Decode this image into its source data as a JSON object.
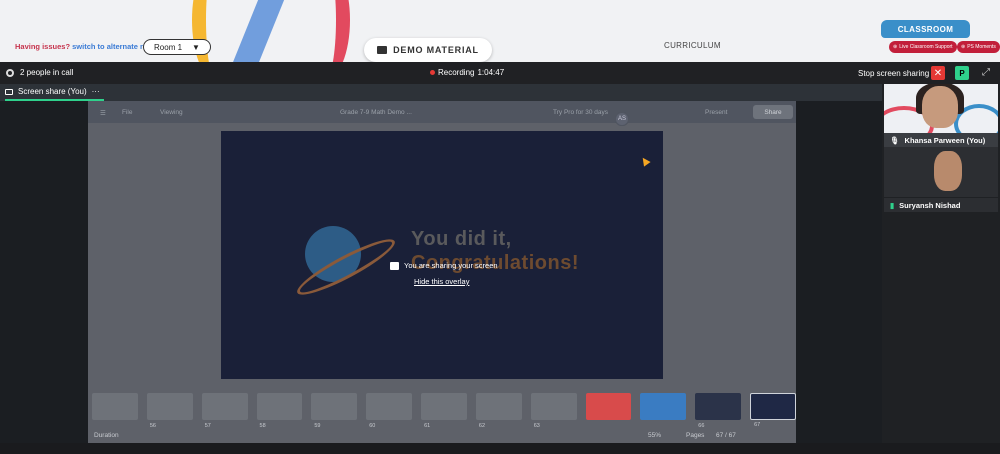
{
  "header": {
    "issue_prefix": "Having issues?",
    "issue_link": "switch to alternate room",
    "room_label": "Room 1",
    "room_caret": "▼",
    "demo_material": "DEMO MATERIAL",
    "curriculum": "CURRICULUM",
    "classroom_tab": "CLASSROOM",
    "live_support": "Live Classroom Support",
    "ps_moments": "PS Moments"
  },
  "callbar": {
    "people": "2 people in call",
    "recording_label": "Recording",
    "recording_time": "1:04:47",
    "stop_sharing": "Stop screen sharing",
    "close_glyph": "✕",
    "p_label": "P",
    "expand_glyph": "⤢"
  },
  "share_tab": {
    "label": "Screen share (You)",
    "more": "···"
  },
  "shared_app": {
    "menu_glyph": "☰",
    "file": "File",
    "viewing": "Viewing",
    "doc_title": "Grade 7-9 Math Demo ...",
    "try_pro": "Try Pro for 30 days",
    "avatars": [
      "#6a8e5a",
      "#3e7bb8",
      "#c96b3b",
      "#8a5aa8"
    ],
    "avatar_text": "AS",
    "present": "Present",
    "share": "Share",
    "slide_line1": "You did it,",
    "slide_line2": "Congratulations!",
    "thumb_numbers": [
      "",
      "56",
      "57",
      "58",
      "59",
      "60",
      "61",
      "62",
      "63",
      "",
      "",
      "66",
      "67"
    ],
    "duration": "Duration",
    "zoom": "55%",
    "pages": "Pages",
    "page_count": "67 / 67"
  },
  "overlay": {
    "sharing_msg": "You are sharing your screen",
    "hide_link": "Hide this overlay"
  },
  "participants": [
    {
      "name": "Khansa Parween (You)"
    },
    {
      "name": "Suryansh Nishad"
    }
  ],
  "colors": {
    "accent_green": "#2fd18c",
    "stop_red": "#e53935",
    "classroom_blue": "#3a8fc9"
  }
}
